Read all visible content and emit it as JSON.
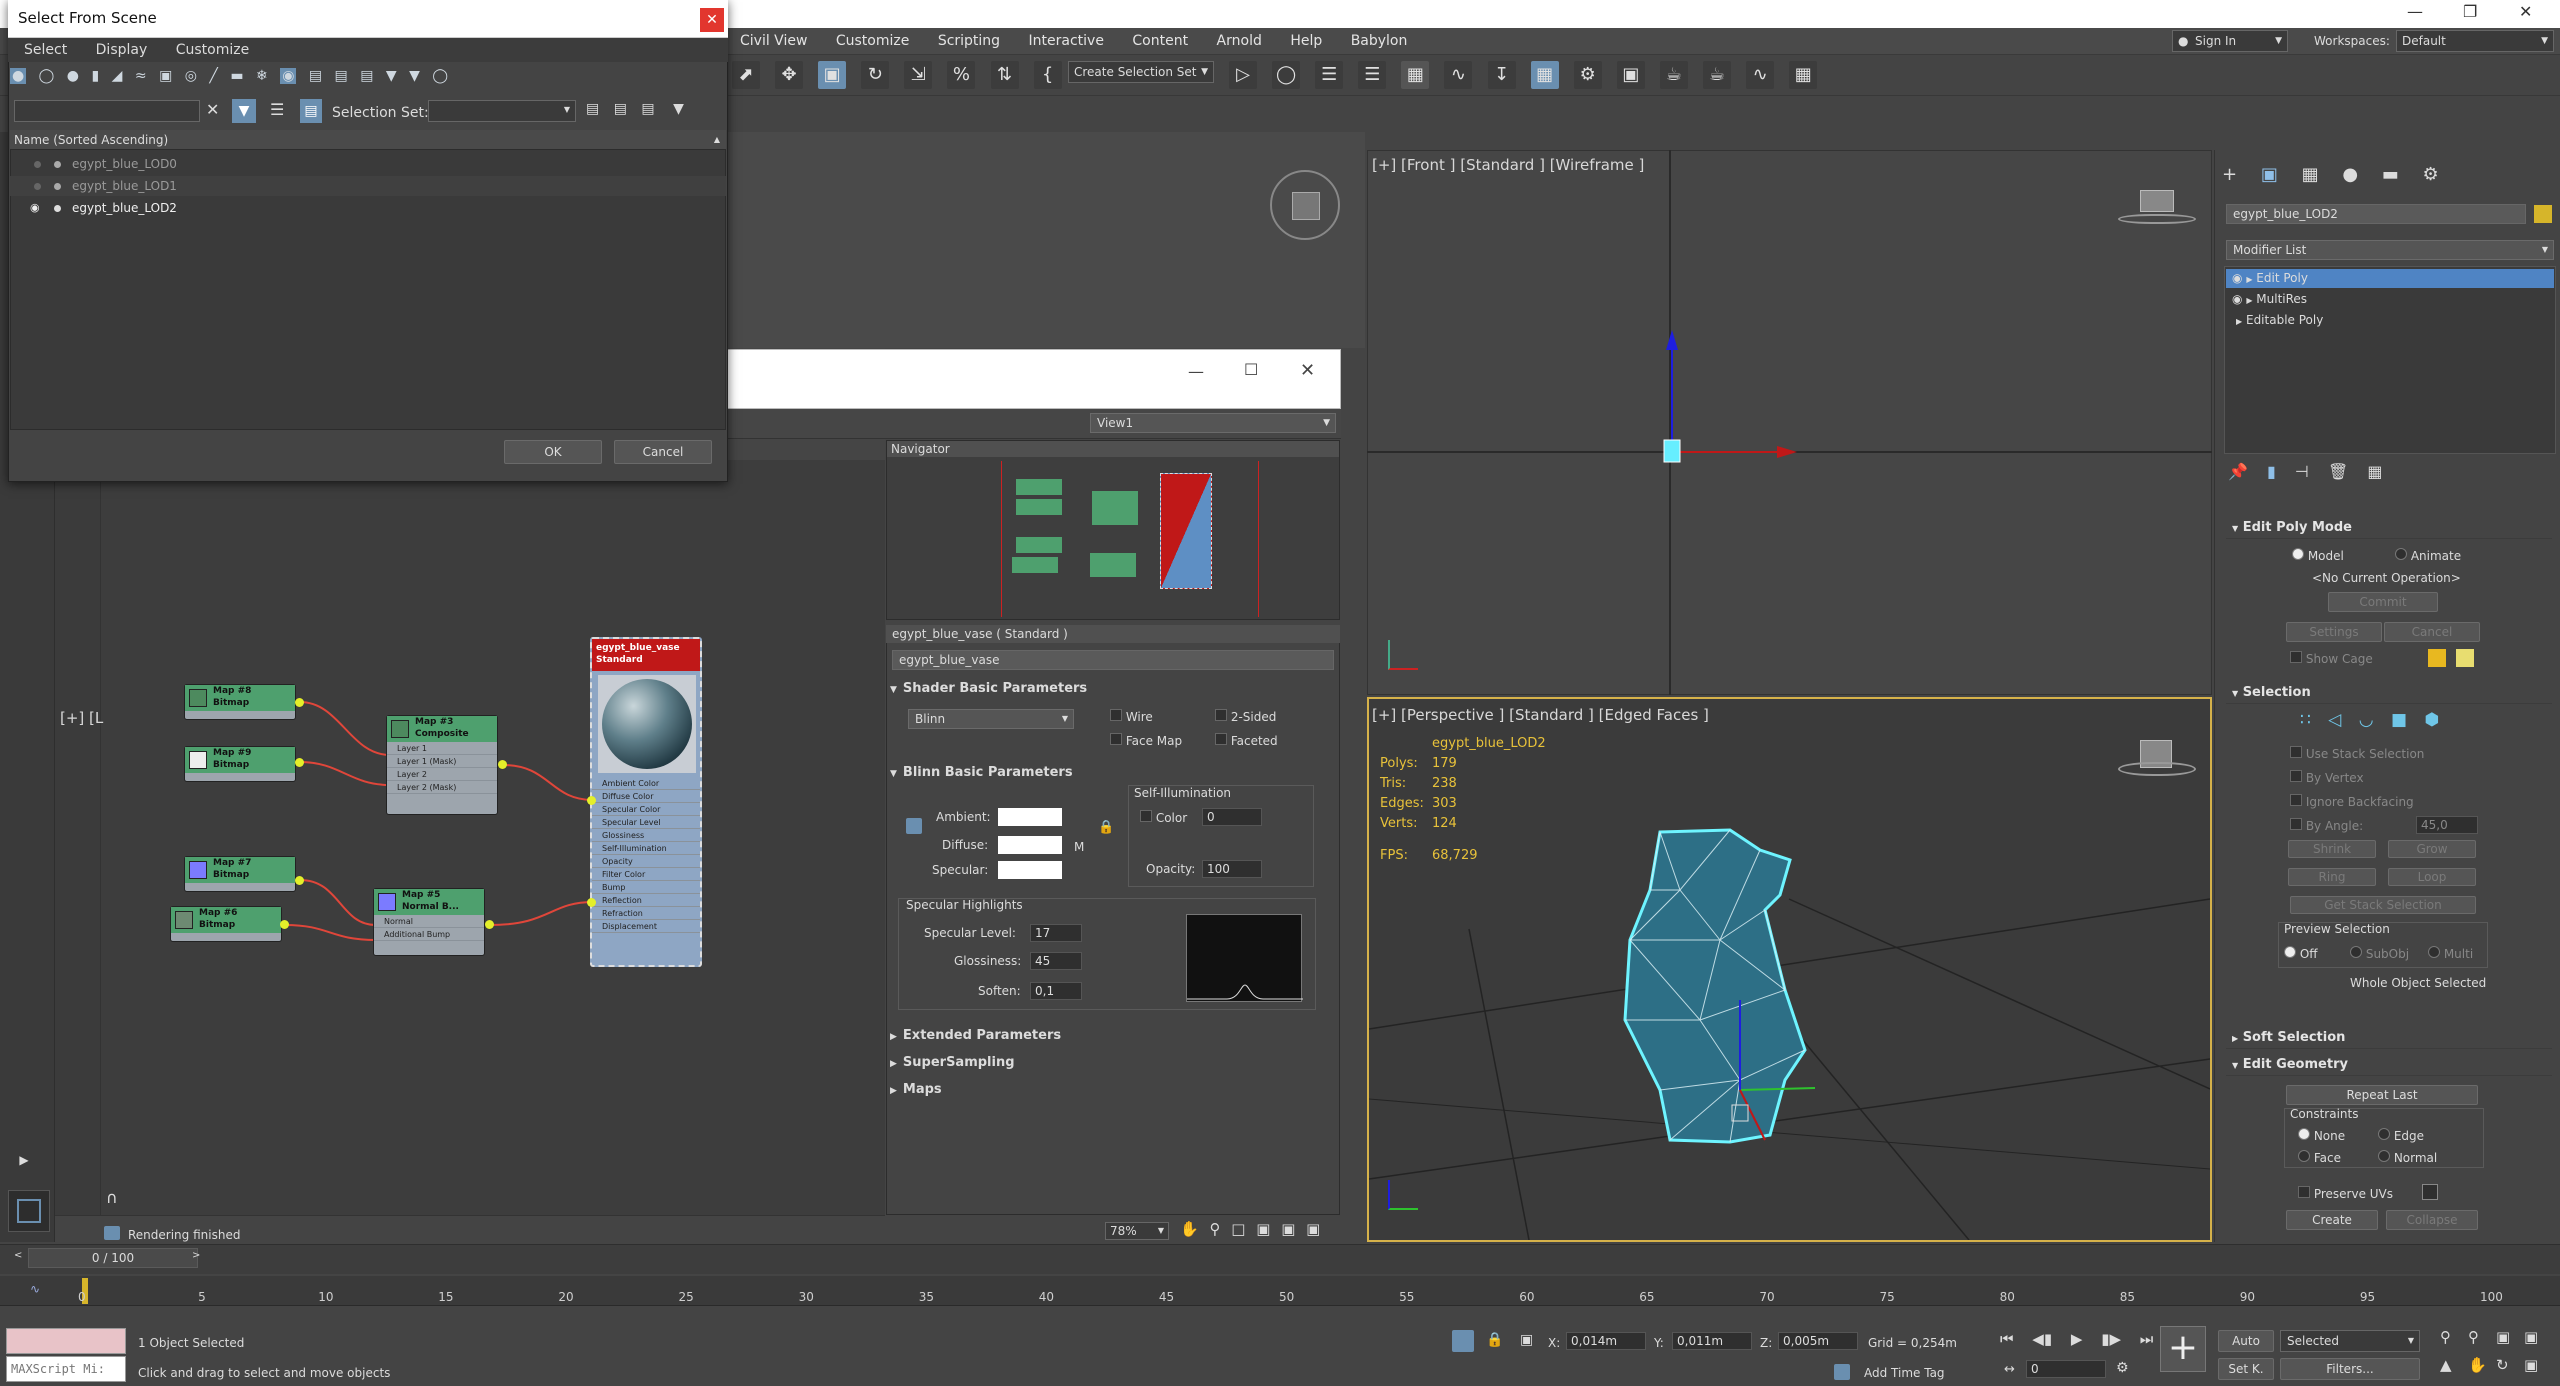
{
  "main_menu": [
    "Civil View",
    "Customize",
    "Scripting",
    "Interactive",
    "Content",
    "Arnold",
    "Help",
    "Babylon"
  ],
  "signin": "Sign In",
  "workspaces_label": "Workspaces:",
  "workspaces_value": "Default",
  "create_selection_set": "Create Selection Set",
  "select_dialog": {
    "title": "Select From Scene",
    "menu": [
      "Select",
      "Display",
      "Customize"
    ],
    "selection_set_label": "Selection Set:",
    "column_header": "Name (Sorted Ascending)",
    "items": [
      "egypt_blue_LOD0",
      "egypt_blue_LOD1",
      "egypt_blue_LOD2"
    ],
    "ok": "OK",
    "cancel": "Cancel"
  },
  "slate": {
    "view_dropdown": "View1",
    "navigator_title": "Navigator",
    "zoom": "78%",
    "status": "Rendering finished",
    "nodes": {
      "map8": [
        "Map #8",
        "Bitmap"
      ],
      "map9": [
        "Map #9",
        "Bitmap"
      ],
      "map3": [
        "Map #3",
        "Composite"
      ],
      "map3_slots": [
        "Layer 1",
        "Layer 1 (Mask)",
        "Layer 2",
        "Layer 2 (Mask)"
      ],
      "map7": [
        "Map #7",
        "Bitmap"
      ],
      "map6": [
        "Map #6",
        "Bitmap"
      ],
      "map5": [
        "Map #5",
        "Normal B..."
      ],
      "map5_slots": [
        "Normal",
        "Additional Bump"
      ],
      "mat": [
        "egypt_blue_vase",
        "Standard"
      ],
      "mat_slots": [
        "Ambient Color",
        "Diffuse Color",
        "Specular Color",
        "Specular Level",
        "Glossiness",
        "Self-Illumination",
        "Opacity",
        "Filter Color",
        "Bump",
        "Reflection",
        "Refraction",
        "Displacement"
      ]
    }
  },
  "material_editor": {
    "header": "egypt_blue_vase  ( Standard )",
    "name": "egypt_blue_vase",
    "shader_section": "Shader Basic Parameters",
    "shader": "Blinn",
    "wire": "Wire",
    "two_sided": "2-Sided",
    "face_map": "Face Map",
    "faceted": "Faceted",
    "blinn_section": "Blinn Basic Parameters",
    "ambient": "Ambient:",
    "diffuse": "Diffuse:",
    "specular": "Specular:",
    "m_btn": "M",
    "self_illum": "Self-Illumination",
    "color": "Color",
    "color_val": "0",
    "opacity": "Opacity:",
    "opacity_val": "100",
    "spec_highlights": "Specular Highlights",
    "spec_level": "Specular Level:",
    "spec_level_val": "17",
    "glossiness": "Glossiness:",
    "glossiness_val": "45",
    "soften": "Soften:",
    "soften_val": "0,1",
    "extended": "Extended Parameters",
    "supersampling": "SuperSampling",
    "maps": "Maps"
  },
  "viewports": {
    "front": "[+] [Front ] [Standard ] [Wireframe ]",
    "persp": "[+] [Perspective ] [Standard ] [Edged Faces ]",
    "left_partial": "[+] [L",
    "stats_obj": "egypt_blue_LOD2",
    "stats": [
      [
        "Polys:",
        "179"
      ],
      [
        "Tris:",
        "238"
      ],
      [
        "Edges:",
        "303"
      ],
      [
        "Verts:",
        "124"
      ]
    ],
    "fps_label": "FPS:",
    "fps": "68,729"
  },
  "cmd_panel": {
    "object_name": "egypt_blue_LOD2",
    "modifier_list": "Modifier List",
    "stack": [
      "Edit Poly",
      "MultiRes",
      "Editable Poly"
    ],
    "edit_poly_mode": "Edit Poly Mode",
    "model": "Model",
    "animate": "Animate",
    "no_op": "<No Current Operation>",
    "commit": "Commit",
    "settings": "Settings",
    "cancel": "Cancel",
    "show_cage": "Show Cage",
    "selection": "Selection",
    "use_stack": "Use Stack Selection",
    "by_vertex": "By Vertex",
    "ignore_backfacing": "Ignore Backfacing",
    "by_angle": "By Angle:",
    "angle_val": "45,0",
    "shrink": "Shrink",
    "grow": "Grow",
    "ring": "Ring",
    "loop": "Loop",
    "get_stack": "Get Stack Selection",
    "preview_sel": "Preview Selection",
    "off": "Off",
    "subobj": "SubObj",
    "multi": "Multi",
    "whole_obj": "Whole Object Selected",
    "soft_sel": "Soft Selection",
    "edit_geom": "Edit Geometry",
    "repeat_last": "Repeat Last",
    "constraints": "Constraints",
    "none": "None",
    "edge": "Edge",
    "face": "Face",
    "normal": "Normal",
    "preserve_uvs": "Preserve UVs",
    "create": "Create",
    "collapse": "Collapse"
  },
  "timeline": {
    "frame": "0 / 100",
    "ticks": [
      "0",
      "5",
      "10",
      "15",
      "20",
      "25",
      "30",
      "35",
      "40",
      "45",
      "50",
      "55",
      "60",
      "65",
      "70",
      "75",
      "80",
      "85",
      "90",
      "95",
      "100"
    ]
  },
  "status": {
    "maxscript": "MAXScript Mi:",
    "selected": "1 Object Selected",
    "hint": "Click and drag to select and move objects",
    "x_label": "X:",
    "x": "0,014m",
    "y_label": "Y:",
    "y": "0,011m",
    "z_label": "Z:",
    "z": "0,005m",
    "grid": "Grid = 0,254m",
    "add_time_tag": "Add Time Tag",
    "auto": "Auto",
    "set_k": "Set K.",
    "selected_dd": "Selected",
    "filters": "Filters...",
    "frame_field": "0"
  }
}
